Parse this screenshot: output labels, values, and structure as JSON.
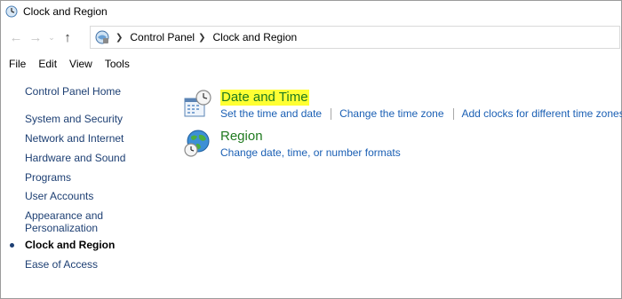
{
  "window": {
    "title": "Clock and Region"
  },
  "navigation": {
    "breadcrumbs": [
      "Control Panel",
      "Clock and Region"
    ]
  },
  "menu": [
    "File",
    "Edit",
    "View",
    "Tools"
  ],
  "sidebar": {
    "home": "Control Panel Home",
    "items": [
      {
        "label": "System and Security"
      },
      {
        "label": "Network and Internet"
      },
      {
        "label": "Hardware and Sound"
      },
      {
        "label": "Programs"
      },
      {
        "label": "User Accounts"
      },
      {
        "label": "Appearance and"
      },
      {
        "label": "Personalization"
      },
      {
        "label": "Clock and Region",
        "current": true
      },
      {
        "label": "Ease of Access"
      }
    ]
  },
  "categories": [
    {
      "title": "Date and Time",
      "highlighted": true,
      "icon": "calendar-clock-icon",
      "links": [
        "Set the time and date",
        "Change the time zone",
        "Add clocks for different time zones"
      ]
    },
    {
      "title": "Region",
      "highlighted": false,
      "icon": "globe-clock-icon",
      "links": [
        "Change date, time, or number formats"
      ]
    }
  ],
  "colors": {
    "link": "#1a5fb4",
    "sidebar_link": "#1d3f73",
    "category_title": "#1f7a1f",
    "highlight": "#ffff33"
  }
}
